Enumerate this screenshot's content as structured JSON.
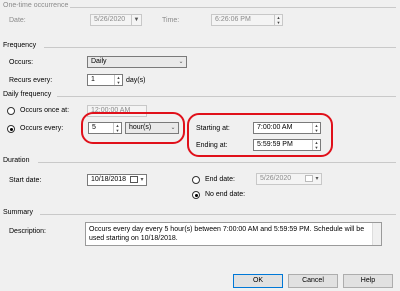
{
  "one_time": {
    "heading": "One-time occurrence",
    "date_label": "Date:",
    "date_value": "5/26/2020",
    "time_label": "Time:",
    "time_value": "6:26:06 PM"
  },
  "frequency": {
    "heading": "Frequency",
    "occurs_label": "Occurs:",
    "occurs_value": "Daily",
    "recurs_label": "Recurs every:",
    "recurs_value": "1",
    "recurs_unit": "day(s)"
  },
  "daily": {
    "heading": "Daily frequency",
    "once_label": "Occurs once at:",
    "once_value": "12:00:00 AM",
    "every_label": "Occurs every:",
    "every_value": "5",
    "every_unit": "hour(s)",
    "starting_label": "Starting at:",
    "starting_value": "7:00:00 AM",
    "ending_label": "Ending at:",
    "ending_value": "5:59:59 PM"
  },
  "duration": {
    "heading": "Duration",
    "start_label": "Start date:",
    "start_value": "10/18/2018",
    "end_label": "End date:",
    "end_value": "5/26/2020",
    "no_end_label": "No end date:"
  },
  "summary": {
    "heading": "Summary",
    "desc_label": "Description:",
    "text": "Occurs every day every 5 hour(s) between 7:00:00 AM and 5:59:59 PM. Schedule will be used starting on 10/18/2018."
  },
  "buttons": {
    "ok": "OK",
    "cancel": "Cancel",
    "help": "Help"
  },
  "colors": {
    "highlight": "#e0101a",
    "accent": "#0078d7"
  }
}
